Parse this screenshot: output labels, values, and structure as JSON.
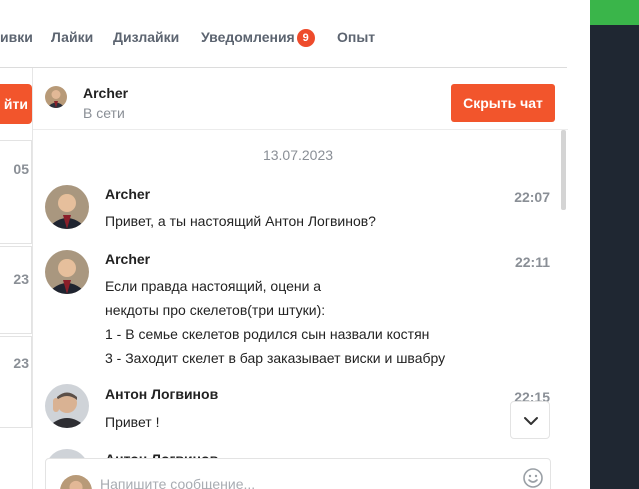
{
  "nav": {
    "tabs": [
      {
        "label": "ивки"
      },
      {
        "label": "Лайки"
      },
      {
        "label": "Дизлайки"
      },
      {
        "label": "Уведомления",
        "badge": "9"
      },
      {
        "label": "Опыт"
      }
    ]
  },
  "left_column": {
    "button_fragment": "йти",
    "times": [
      "05",
      "23",
      "23"
    ]
  },
  "chat": {
    "header": {
      "name": "Archer",
      "status": "В сети",
      "hide_button": "Скрыть чат"
    },
    "date": "13.07.2023",
    "messages": [
      {
        "author": "Archer",
        "time": "22:07",
        "lines": [
          "Привет, а ты настоящий Антон Логвинов?"
        ]
      },
      {
        "author": "Archer",
        "time": "22:11",
        "lines": [
          "Если правда настоящий, оцени а",
          "некдоты про скелетов(три штуки):",
          "1 - В семье скелетов родился сын назвали костян",
          "3 - Заходит скелет в бар заказывает виски и швабру"
        ]
      },
      {
        "author": "Антон Логвинов",
        "time": "22:15",
        "lines": [
          "Привет !"
        ]
      },
      {
        "author": "Антон Логвинов",
        "time": "",
        "lines": []
      }
    ],
    "composer": {
      "placeholder": "Напишите сообщение..."
    }
  },
  "colors": {
    "accent": "#f2552c",
    "badge": "#ee4b2b",
    "dark_panel": "#1f2732",
    "green": "#3ab54a"
  },
  "icons": [
    "chevron-down-icon",
    "emoji-icon"
  ]
}
